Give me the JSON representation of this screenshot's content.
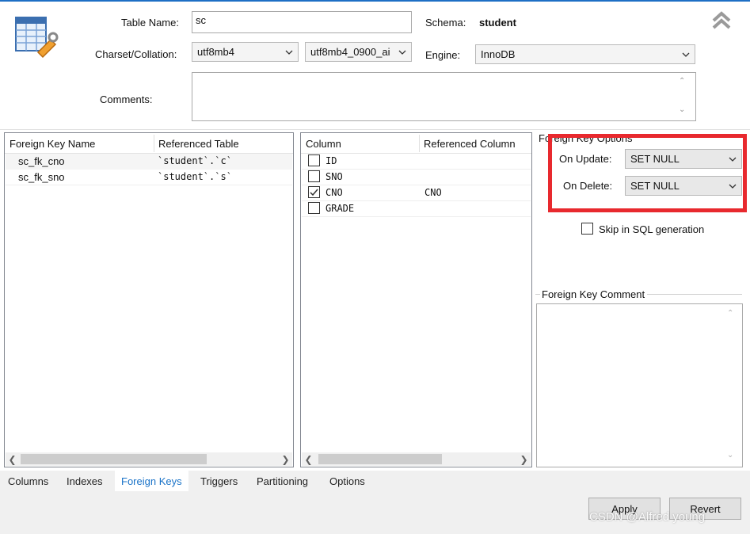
{
  "header": {
    "table_name_label": "Table Name:",
    "table_name_value": "sc",
    "schema_label": "Schema:",
    "schema_value": "student",
    "charset_label": "Charset/Collation:",
    "charset_value": "utf8mb4",
    "collation_value": "utf8mb4_0900_ai",
    "engine_label": "Engine:",
    "engine_value": "InnoDB",
    "comments_label": "Comments:",
    "comments_value": ""
  },
  "fk_table": {
    "columns": [
      "Foreign Key Name",
      "Referenced Table"
    ],
    "rows": [
      {
        "name": "sc_fk_cno",
        "ref": "`student`.`c`"
      },
      {
        "name": "sc_fk_sno",
        "ref": "`student`.`s`"
      }
    ]
  },
  "col_table": {
    "columns": [
      "Column",
      "Referenced Column"
    ],
    "rows": [
      {
        "column": "ID",
        "checked": false,
        "ref": ""
      },
      {
        "column": "SNO",
        "checked": false,
        "ref": ""
      },
      {
        "column": "CNO",
        "checked": true,
        "ref": "CNO"
      },
      {
        "column": "GRADE",
        "checked": false,
        "ref": ""
      }
    ]
  },
  "fk_options": {
    "title": "Foreign Key Options",
    "on_update_label": "On Update:",
    "on_update_value": "SET NULL",
    "on_delete_label": "On Delete:",
    "on_delete_value": "SET NULL",
    "skip_sql_label": "Skip in SQL generation",
    "skip_sql_checked": false,
    "comment_title": "Foreign Key Comment",
    "comment_value": ""
  },
  "tabs": [
    {
      "label": "Columns",
      "active": false
    },
    {
      "label": "Indexes",
      "active": false
    },
    {
      "label": "Foreign Keys",
      "active": true
    },
    {
      "label": "Triggers",
      "active": false
    },
    {
      "label": "Partitioning",
      "active": false
    },
    {
      "label": "Options",
      "active": false
    }
  ],
  "buttons": {
    "apply": "Apply",
    "revert": "Revert"
  },
  "watermark": "CSDN @Alfred young",
  "colors": {
    "highlight_box": "#e8292e",
    "active_tab": "#1a73c8"
  }
}
